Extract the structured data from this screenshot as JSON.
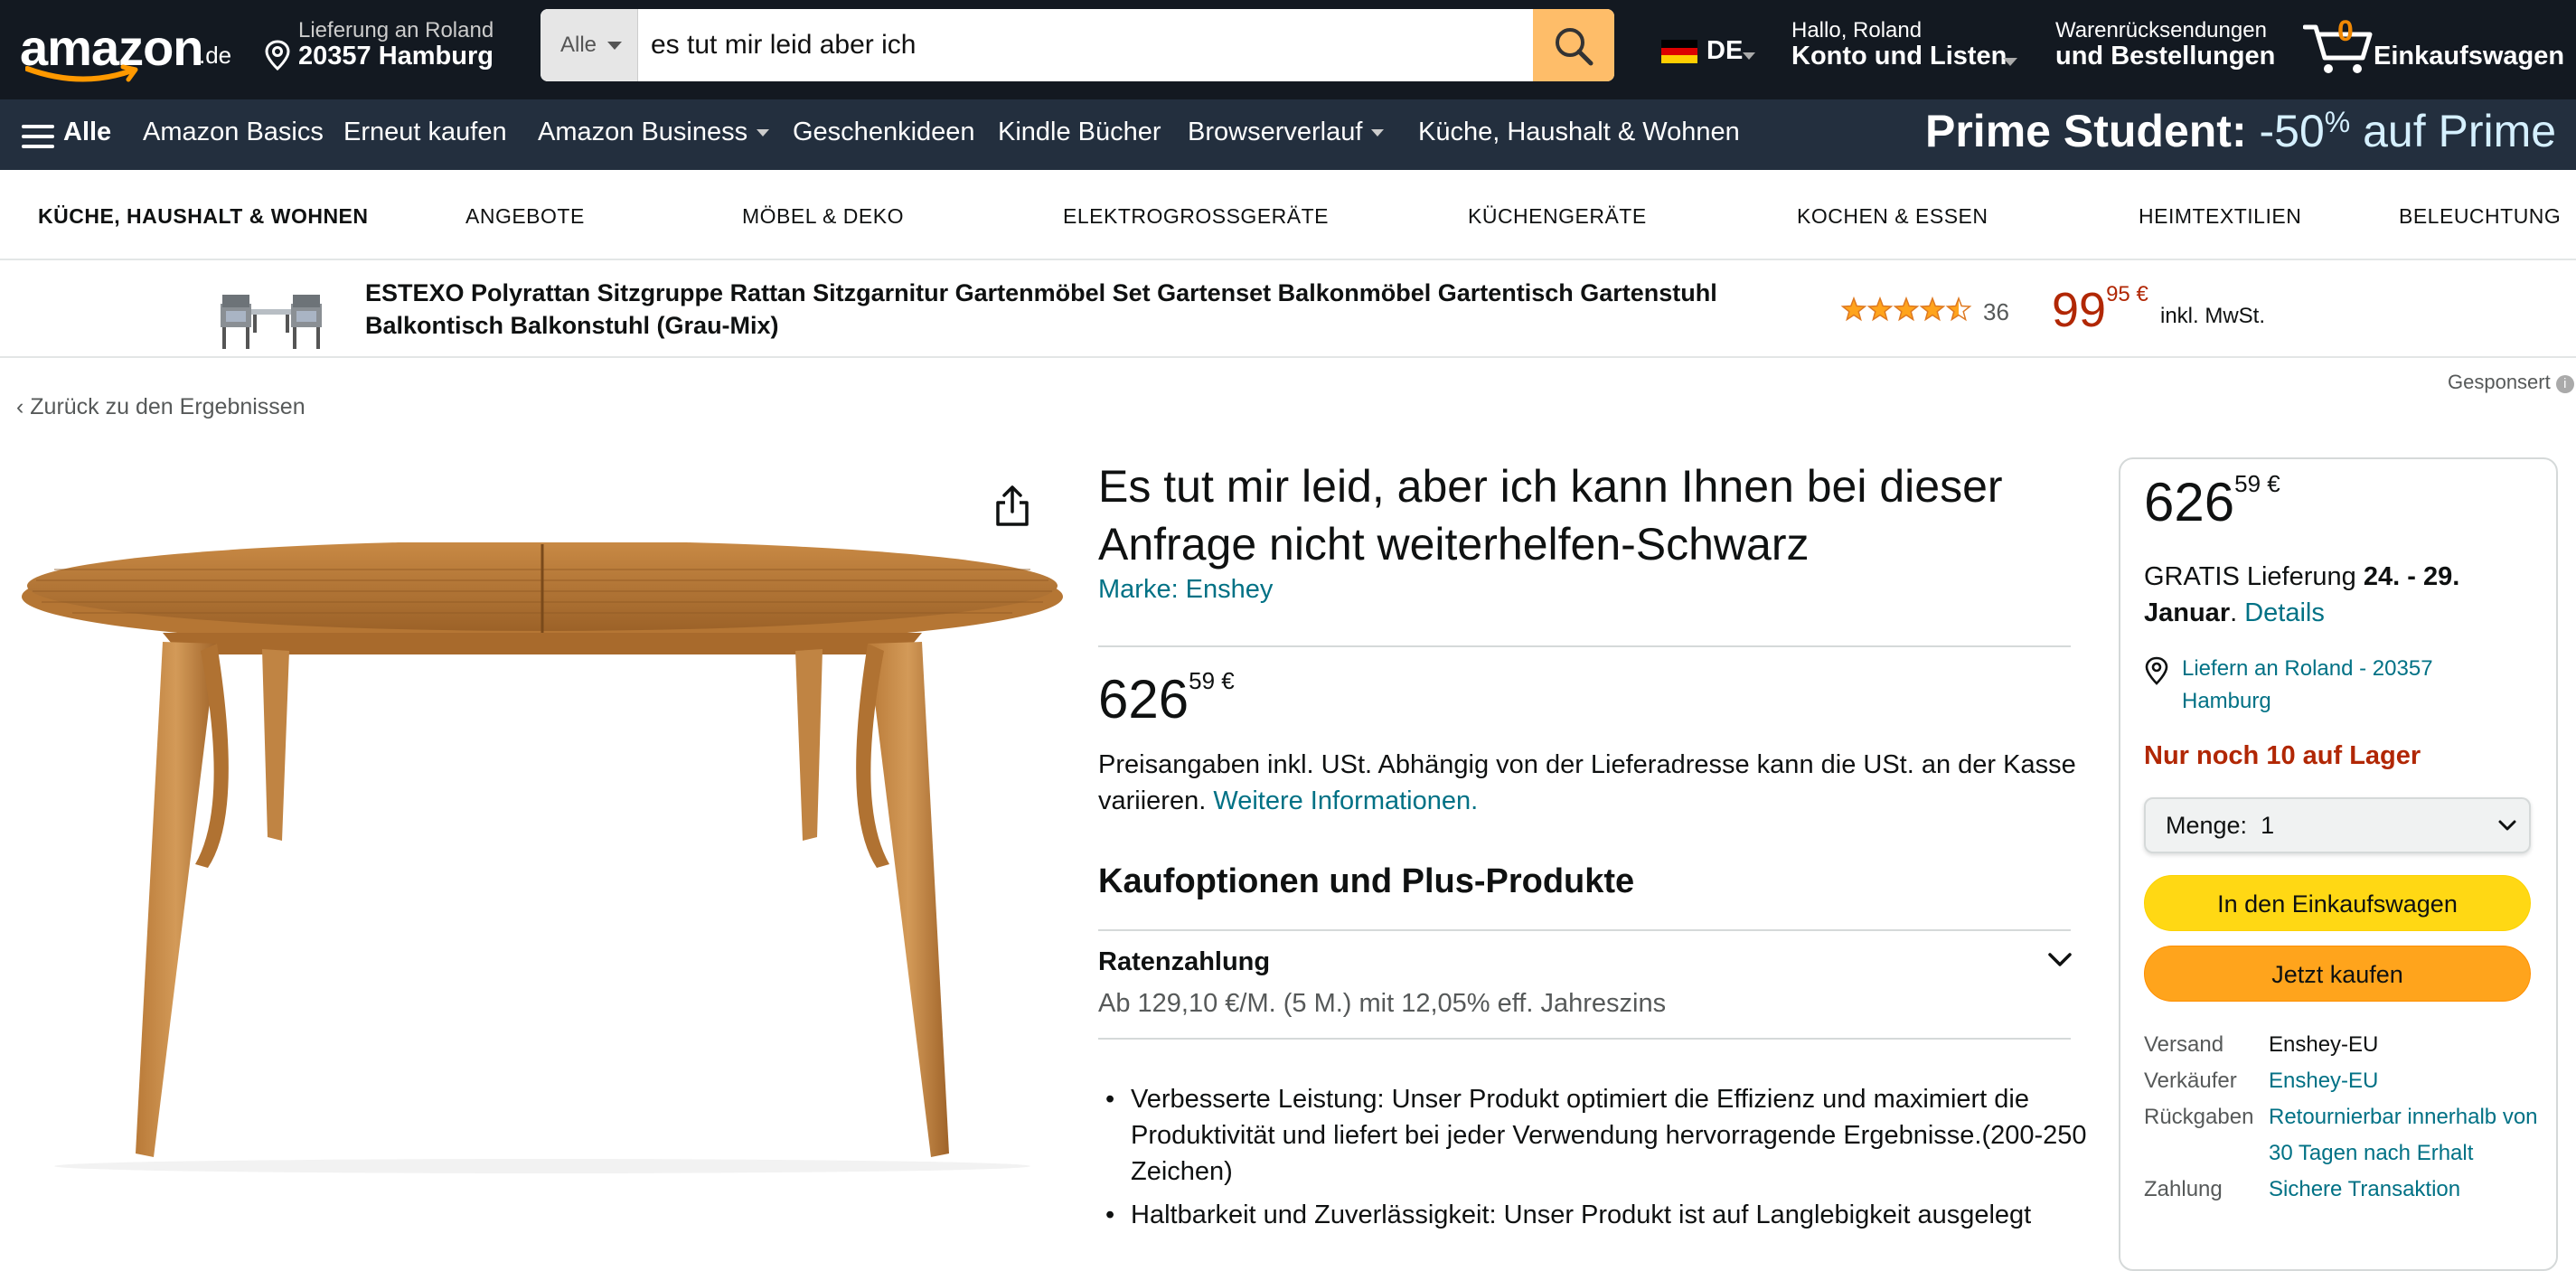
{
  "header": {
    "logo": {
      "word": "amazon",
      "tld": ".de"
    },
    "delivery": {
      "line1": "Lieferung an Roland",
      "line2": "20357 Hamburg"
    },
    "search": {
      "category": "Alle",
      "query": "es tut mir leid aber ich"
    },
    "language": "DE",
    "account": {
      "line1": "Hallo, Roland",
      "line2": "Konto und Listen"
    },
    "orders": {
      "line1": "Warenrücksendungen",
      "line2": "und Bestellungen"
    },
    "cart": {
      "count": "0",
      "label": "Einkaufswagen"
    }
  },
  "nav": {
    "all_label": "Alle",
    "items": [
      "Amazon Basics",
      "Erneut kaufen",
      "Amazon Business",
      "Geschenkideen",
      "Kindle Bücher",
      "Browserverlauf",
      "Küche, Haushalt & Wohnen"
    ],
    "promo": {
      "bold": "Prime Student:",
      "discount": "-50",
      "percent": "%",
      "rest": "auf Prime"
    }
  },
  "category_bar": [
    "KÜCHE, HAUSHALT & WOHNEN",
    "ANGEBOTE",
    "MÖBEL & DEKO",
    "ELEKTROGROSSGERÄTE",
    "KÜCHENGERÄTE",
    "KOCHEN & ESSEN",
    "HEIMTEXTILIEN",
    "BELEUCHTUNG"
  ],
  "sponsored": {
    "title": "ESTEXO Polyrattan Sitzgruppe Rattan Sitzgarnitur Gartenmöbel Set Gartenset Balkonmöbel Gartentisch Gartenstuhl Balkontisch Balkonstuhl (Grau-Mix)",
    "rating": 4.5,
    "rating_count": "36",
    "price_whole": "99",
    "price_fraction": "95 €",
    "tax_note": "inkl. MwSt.",
    "sponsored_label": "Gesponsert"
  },
  "back_link": "Zurück zu den Ergebnissen",
  "product": {
    "title": "Es tut mir leid, aber ich kann Ihnen bei dieser Anfrage nicht weiterhelfen-Schwarz",
    "brand": "Marke: Enshey",
    "price_whole": "626",
    "price_fraction": "59 €",
    "tax_text": "Preisangaben inkl. USt. Abhängig von der Lieferadresse kann die USt. an der Kasse variieren.",
    "tax_link": "Weitere Informationen.",
    "options_heading": "Kaufoptionen und Plus-Produkte",
    "installment_heading": "Ratenzahlung",
    "installment_text": "Ab 129,10 €/M. (5 M.) mit 12,05% eff. Jahreszins",
    "bullets": [
      "Verbesserte Leistung: Unser Produkt optimiert die Effizienz und maximiert die Produktivität und liefert bei jeder Verwendung hervorragende Ergebnisse.(200-250 Zeichen)",
      "Haltbarkeit und Zuverlässigkeit: Unser Produkt ist auf Langlebigkeit ausgelegt"
    ]
  },
  "buybox": {
    "price_whole": "626",
    "price_fraction": "59 €",
    "delivery_prefix": "GRATIS Lieferung",
    "delivery_dates": "24. - 29. Januar",
    "delivery_link": "Details",
    "location": "Liefern an Roland - 20357 Hamburg",
    "stock": "Nur noch 10 auf Lager",
    "quantity_label": "Menge:",
    "quantity_value": "1",
    "add_to_cart": "In den Einkaufswagen",
    "buy_now": "Jetzt kaufen",
    "details": [
      {
        "key": "Versand",
        "value": "Enshey-EU",
        "link": false
      },
      {
        "key": "Verkäufer",
        "value": "Enshey-EU",
        "link": true
      },
      {
        "key": "Rückgaben",
        "value": "Retournierbar innerhalb von 30 Tagen nach Erhalt",
        "link": true
      },
      {
        "key": "Zahlung",
        "value": "Sichere Transaktion",
        "link": true
      }
    ]
  },
  "colors": {
    "nav_dark": "#131921",
    "nav_secondary": "#232f3e",
    "link": "#007185",
    "price_red": "#b12704",
    "cart_yellow": "#ffd814",
    "buy_orange": "#ffa41c",
    "search_button": "#febd69"
  }
}
